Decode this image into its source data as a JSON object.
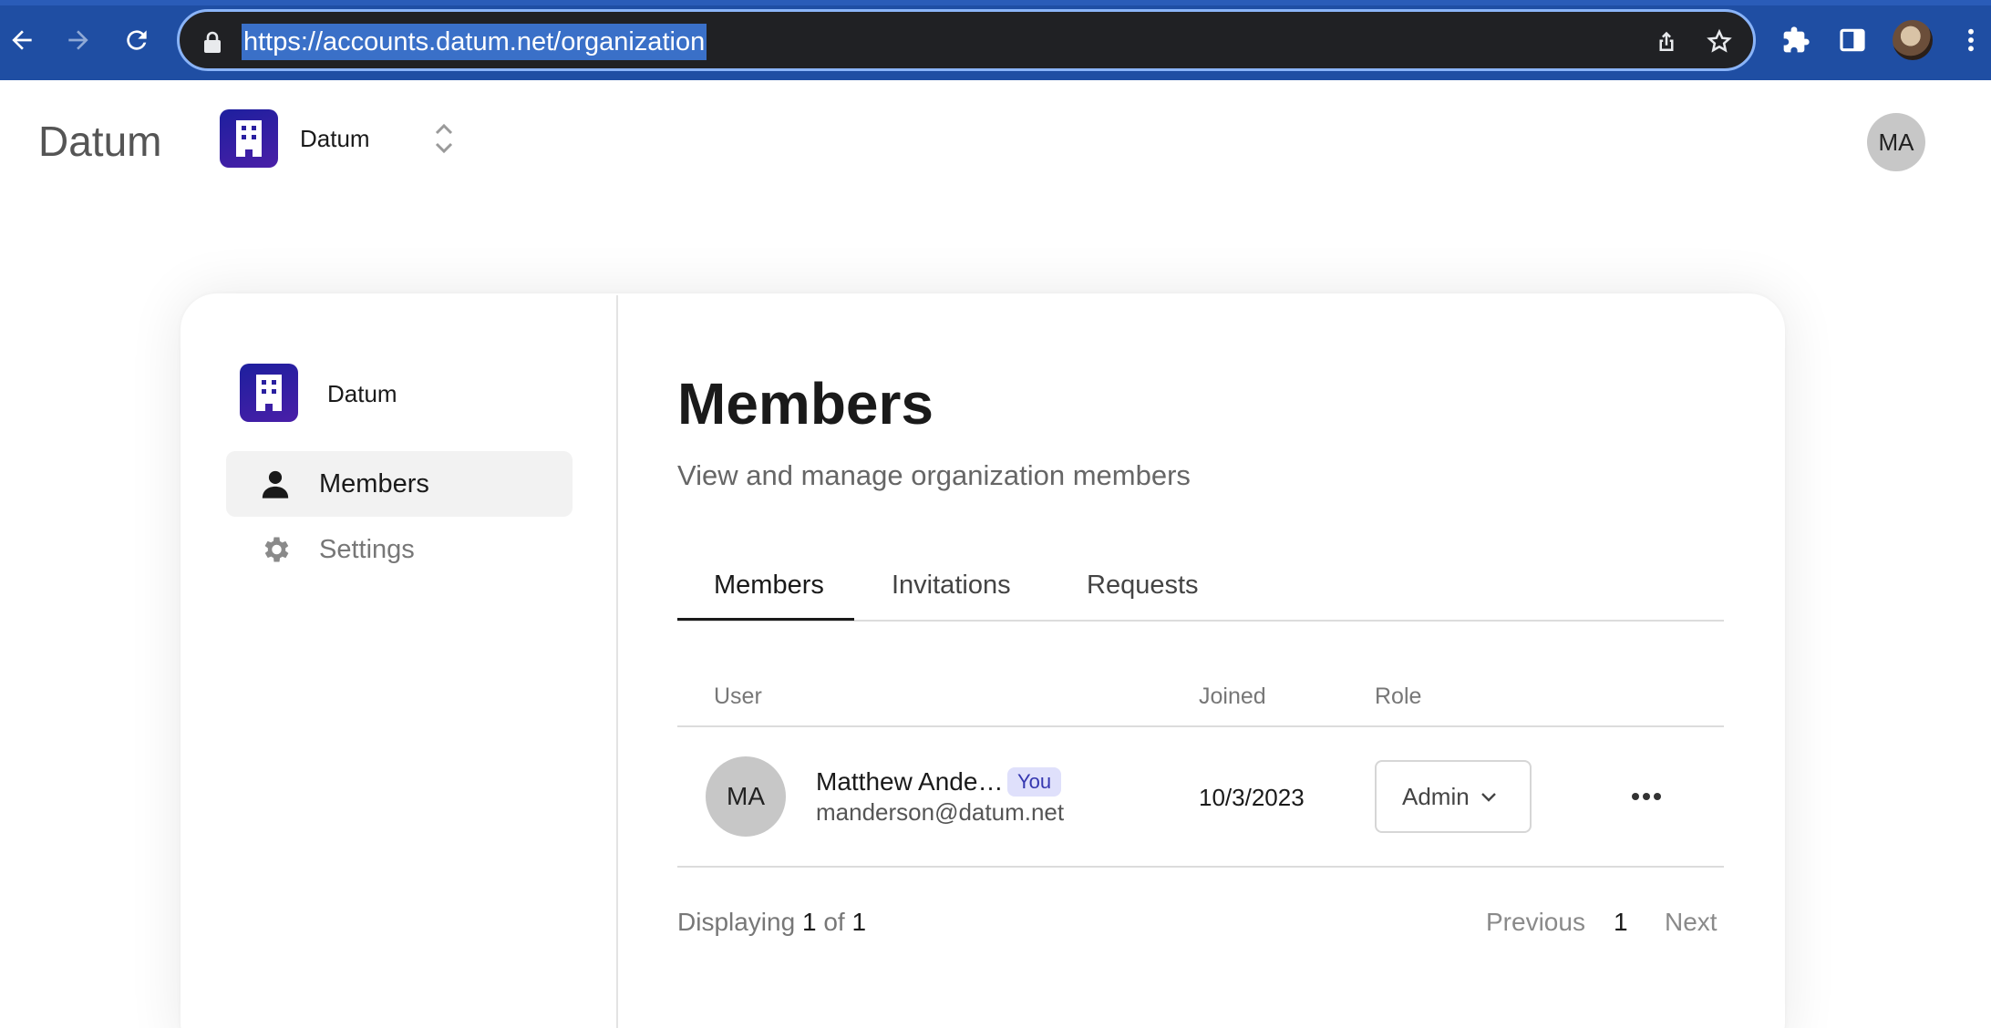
{
  "browser": {
    "url": "https://accounts.datum.net/organization"
  },
  "header": {
    "brand": "Datum",
    "org_name": "Datum",
    "user_initials": "MA"
  },
  "sidebar": {
    "org_name": "Datum",
    "items": [
      {
        "label": "Members",
        "icon": "person-icon",
        "active": true
      },
      {
        "label": "Settings",
        "icon": "gear-icon",
        "active": false
      }
    ]
  },
  "main": {
    "title": "Members",
    "subtitle": "View and manage organization members",
    "tabs": [
      {
        "label": "Members",
        "active": true
      },
      {
        "label": "Invitations",
        "active": false
      },
      {
        "label": "Requests",
        "active": false
      }
    ],
    "table": {
      "columns": [
        "User",
        "Joined",
        "Role"
      ],
      "rows": [
        {
          "initials": "MA",
          "name": "Matthew Ande…",
          "badge": "You",
          "email": "manderson@datum.net",
          "joined": "10/3/2023",
          "role": "Admin"
        }
      ]
    },
    "pagination": {
      "prefix": "Displaying",
      "current": "1",
      "of_word": "of",
      "total": "1",
      "previous_label": "Previous",
      "page": "1",
      "next_label": "Next"
    }
  },
  "colors": {
    "chrome_bg": "#1f4ea3",
    "org_logo": "#1d1f9e",
    "badge_bg": "#dfe0fb",
    "badge_text": "#3537b0"
  }
}
